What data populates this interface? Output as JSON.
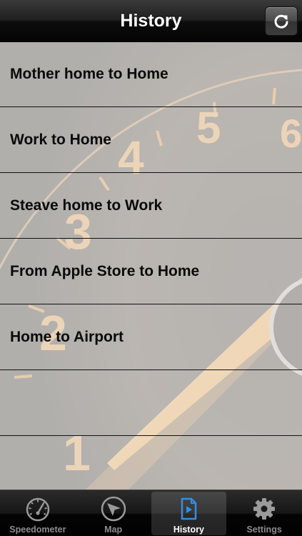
{
  "nav": {
    "title": "History",
    "refresh_icon": "refresh-icon"
  },
  "history": {
    "items": [
      {
        "label": "Mother home to Home"
      },
      {
        "label": "Work to Home"
      },
      {
        "label": "Steave home to Work"
      },
      {
        "label": "From Apple Store to Home"
      },
      {
        "label": "Home to Airport"
      },
      {
        "label": ""
      }
    ]
  },
  "background": {
    "dial_numbers": [
      "1",
      "2",
      "3",
      "4",
      "5",
      "6"
    ],
    "accent": "#f08a1e"
  },
  "tabbar": {
    "tabs": [
      {
        "label": "Speedometer",
        "icon": "speedometer-icon",
        "active": false
      },
      {
        "label": "Map",
        "icon": "navigation-arrow-icon",
        "active": false
      },
      {
        "label": "History",
        "icon": "history-document-icon",
        "active": true
      },
      {
        "label": "Settings",
        "icon": "gear-icon",
        "active": false
      }
    ],
    "inactive_color": "#8c8c8c",
    "active_color": "#ffffff",
    "active_icon_color": "#2f8fe8"
  }
}
